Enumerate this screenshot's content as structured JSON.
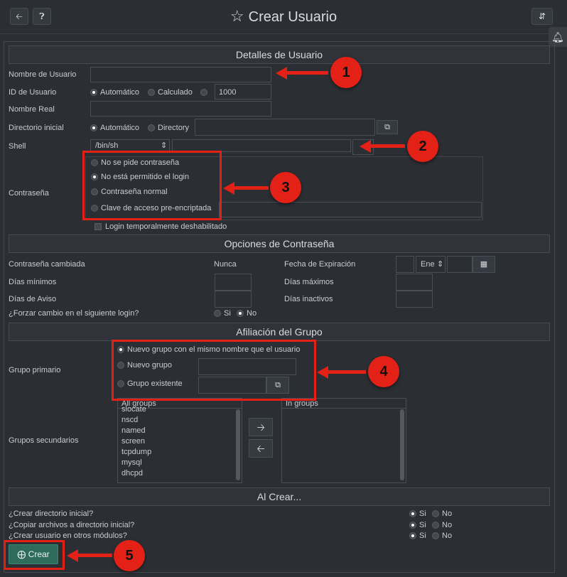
{
  "header": {
    "back_icon": "arrow-left-icon",
    "help_icon": "question-circle-icon",
    "title": "Crear Usuario",
    "right_icon": "filter-icon"
  },
  "sections": {
    "detalles": "Detalles de Usuario",
    "opciones": "Opciones de Contraseña",
    "afiliacion": "Afiliación del Grupo",
    "al_crear": "Al Crear..."
  },
  "user": {
    "nombre_label": "Nombre de Usuario",
    "id_label": "ID de Usuario",
    "id_opt_auto": "Automático",
    "id_opt_calc": "Calculado",
    "id_value": "1000",
    "real_label": "Nombre Real",
    "dir_label": "Directorio inicial",
    "dir_opt_auto": "Automático",
    "dir_opt_dir": "Directory",
    "shell_label": "Shell",
    "shell_value": "/bin/sh",
    "pw_label": "Contraseña",
    "pw_opts": [
      "No se pide contraseña",
      "No está permitido el login",
      "Contraseña normal",
      "Clave de acceso pre-encriptada"
    ],
    "login_disabled": "Login temporalmente deshabilitado"
  },
  "pwopts": {
    "changed_label": "Contraseña cambiada",
    "changed_value": "Nunca",
    "expiry_label": "Fecha de Expiración",
    "month": "Ene",
    "min_label": "Días mínimos",
    "max_label": "Días máximos",
    "warn_label": "Días de Aviso",
    "inactive_label": "Días inactivos",
    "force_label": "¿Forzar cambio en el siguiente login?",
    "yes": "Si",
    "no": "No"
  },
  "group": {
    "primary_label": "Grupo primario",
    "primary_opts": [
      "Nuevo grupo con el mismo nombre que el usuario",
      "Nuevo grupo",
      "Grupo existente"
    ],
    "secondary_label": "Grupos secundarios",
    "all_groups": "All groups",
    "in_groups": "In groups",
    "items": [
      "slocate",
      "nscd",
      "named",
      "screen",
      "tcpdump",
      "mysql",
      "dhcpd"
    ]
  },
  "oncreate": {
    "q1": "¿Crear directorio inicial?",
    "q2": "¿Copiar archivos a directorio inicial?",
    "q3": "¿Crear usuario en otros módulos?",
    "yes": "Si",
    "no": "No"
  },
  "create_button": "Crear",
  "annotations": [
    "1",
    "2",
    "3",
    "4",
    "5"
  ],
  "colors": {
    "annotation": "#e32116",
    "create_button": "#2f6b5b"
  }
}
